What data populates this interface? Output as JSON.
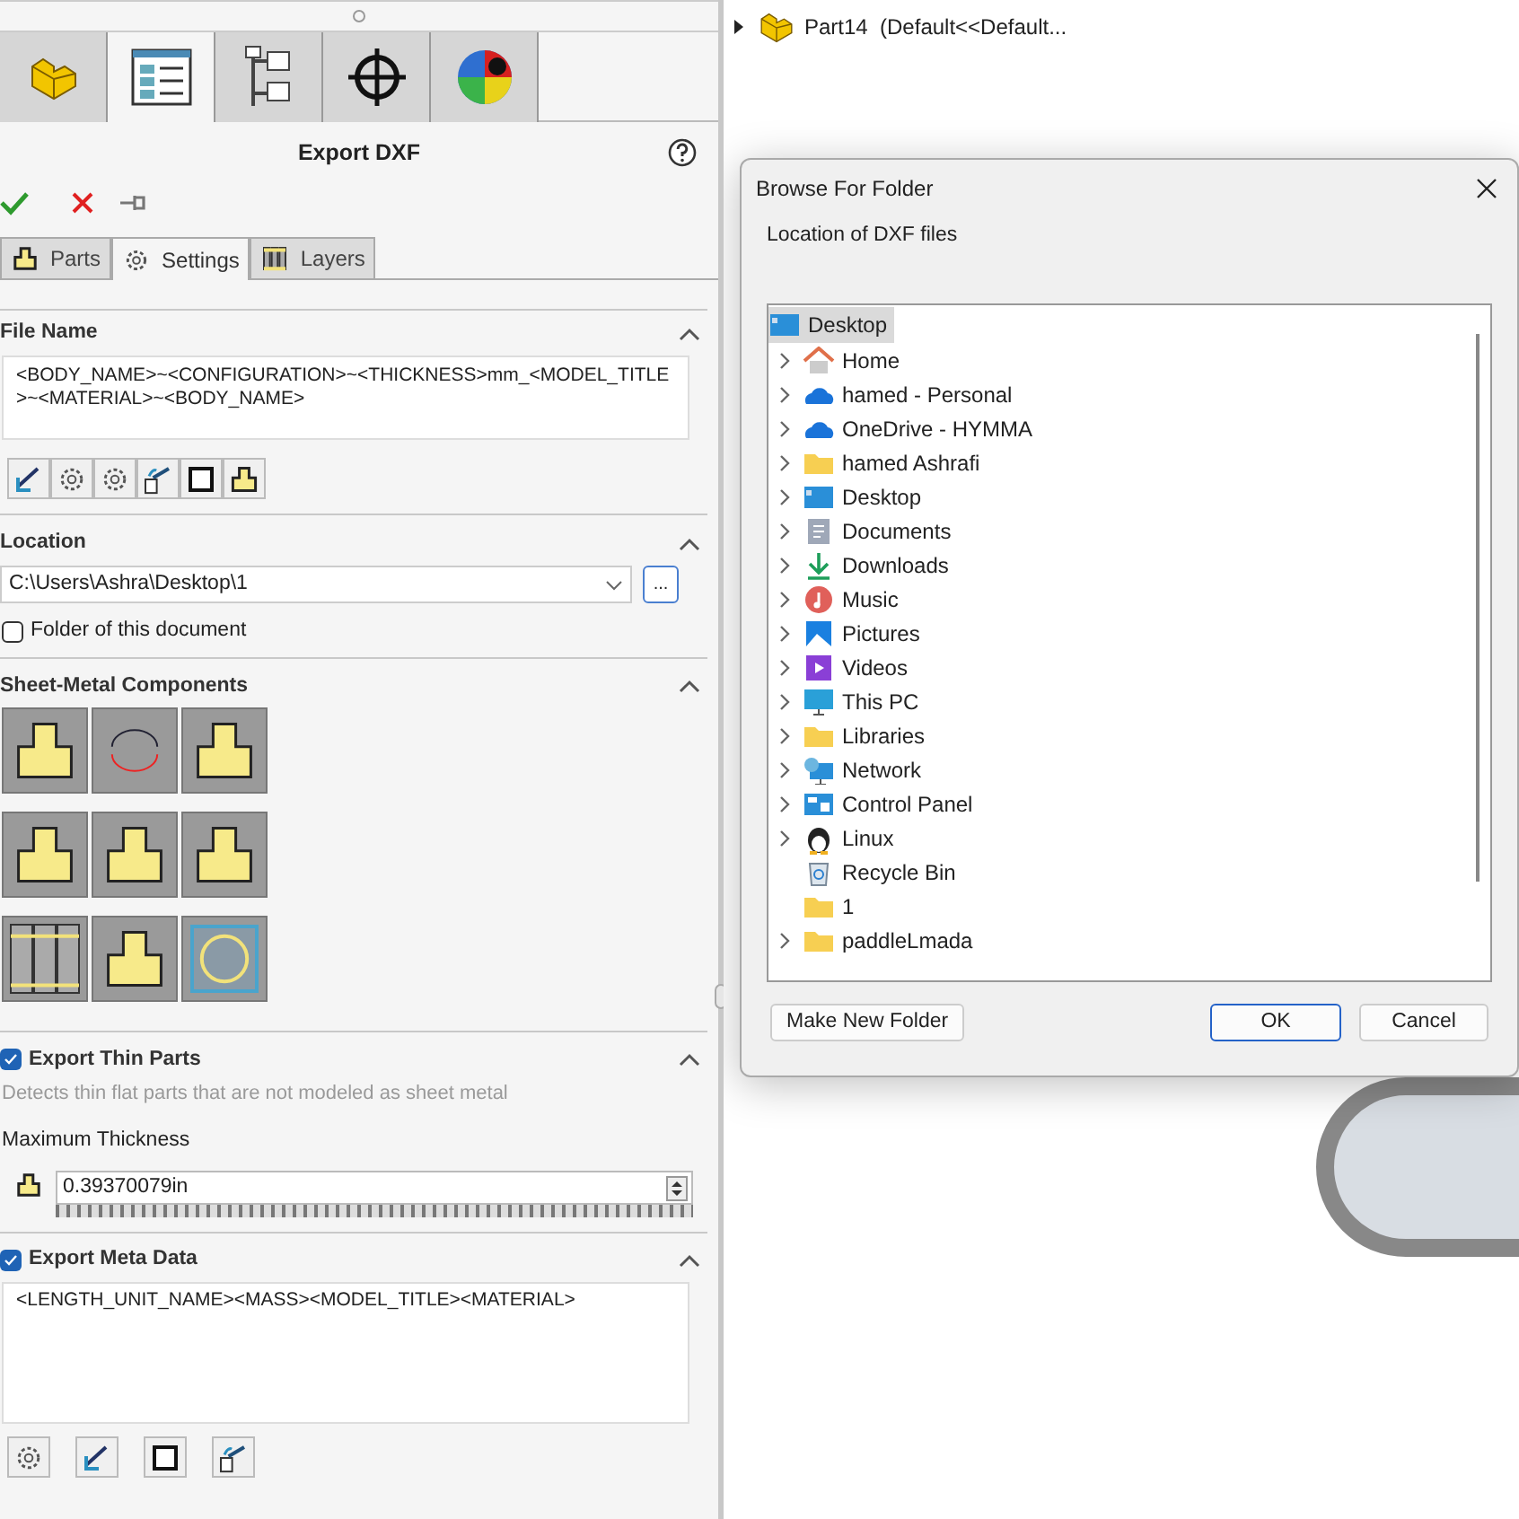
{
  "feature_manager": {
    "tabs": [
      {
        "kind": "part",
        "selected": false
      },
      {
        "kind": "property",
        "selected": true
      },
      {
        "kind": "config",
        "selected": false
      },
      {
        "kind": "crosshair",
        "selected": false
      },
      {
        "kind": "appearance",
        "selected": false
      }
    ]
  },
  "property_manager": {
    "title": "Export DXF",
    "subtabs": [
      {
        "label": "Parts",
        "kind": "part",
        "selected": false
      },
      {
        "label": "Settings",
        "kind": "gear",
        "selected": true
      },
      {
        "label": "Layers",
        "kind": "layers",
        "selected": false
      }
    ],
    "file_name": {
      "heading": "File Name",
      "value": "<BODY_NAME>~<CONFIGURATION>~<THICKNESS>mm_<MODEL_TITLE>~<MATERIAL>~<BODY_NAME>",
      "tools": [
        {
          "kind": "dimension"
        },
        {
          "kind": "gear"
        },
        {
          "kind": "gear"
        },
        {
          "kind": "link"
        },
        {
          "kind": "square"
        },
        {
          "kind": "part"
        }
      ]
    },
    "location": {
      "heading": "Location",
      "value": "C:\\Users\\Ashra\\Desktop\\1",
      "browse": "...",
      "folder_checkbox": {
        "label": "Folder of this document",
        "checked": false
      }
    },
    "components": {
      "heading": "Sheet-Metal Components",
      "tiles": [
        {
          "kind": "part"
        },
        {
          "kind": "cycle"
        },
        {
          "kind": "part"
        },
        {
          "kind": "part"
        },
        {
          "kind": "part"
        },
        {
          "kind": "part"
        },
        {
          "kind": "layers"
        },
        {
          "kind": "part"
        },
        {
          "kind": "circle"
        }
      ]
    },
    "thin_parts": {
      "heading": "Export Thin Parts",
      "checked": true,
      "description": "Detects thin flat parts that are not modeled as sheet metal",
      "thickness_label": "Maximum Thickness",
      "value": "0.39370079in"
    },
    "meta_data": {
      "heading": "Export Meta Data",
      "checked": true,
      "value": "<LENGTH_UNIT_NAME><MASS><MODEL_TITLE><MATERIAL>",
      "tools": [
        {
          "kind": "gear"
        },
        {
          "kind": "dimension"
        },
        {
          "kind": "square"
        },
        {
          "kind": "link"
        }
      ]
    }
  },
  "tree": {
    "label": "Part14  (Default<<Default...",
    "expanded": false
  },
  "dialog": {
    "title": "Browse For Folder",
    "prompt": "Location of DXF files",
    "root": {
      "label": "Desktop",
      "selected": true,
      "children": [
        {
          "label": "Home",
          "kind": "home",
          "expandable": true
        },
        {
          "label": "hamed - Personal",
          "kind": "cloud",
          "expandable": true
        },
        {
          "label": "OneDrive - HYMMA",
          "kind": "cloud",
          "expandable": true
        },
        {
          "label": "hamed Ashrafi",
          "kind": "folder",
          "expandable": true
        },
        {
          "label": "Desktop",
          "kind": "desktop",
          "expandable": true
        },
        {
          "label": "Documents",
          "kind": "documents",
          "expandable": true
        },
        {
          "label": "Downloads",
          "kind": "downloads",
          "expandable": true
        },
        {
          "label": "Music",
          "kind": "music",
          "expandable": true
        },
        {
          "label": "Pictures",
          "kind": "pictures",
          "expandable": true
        },
        {
          "label": "Videos",
          "kind": "videos",
          "expandable": true
        },
        {
          "label": "This PC",
          "kind": "pc",
          "expandable": true
        },
        {
          "label": "Libraries",
          "kind": "folder",
          "expandable": true
        },
        {
          "label": "Network",
          "kind": "network",
          "expandable": true
        },
        {
          "label": "Control Panel",
          "kind": "control",
          "expandable": true
        },
        {
          "label": "Linux",
          "kind": "linux",
          "expandable": true
        },
        {
          "label": "Recycle Bin",
          "kind": "recycle",
          "expandable": false
        },
        {
          "label": "1",
          "kind": "folder",
          "expandable": false
        },
        {
          "label": "paddleLmada",
          "kind": "folder",
          "expandable": true
        }
      ]
    },
    "buttons": [
      {
        "label": "Make New Folder",
        "default": false
      },
      {
        "label": "OK",
        "default": true
      },
      {
        "label": "Cancel",
        "default": false
      }
    ]
  }
}
